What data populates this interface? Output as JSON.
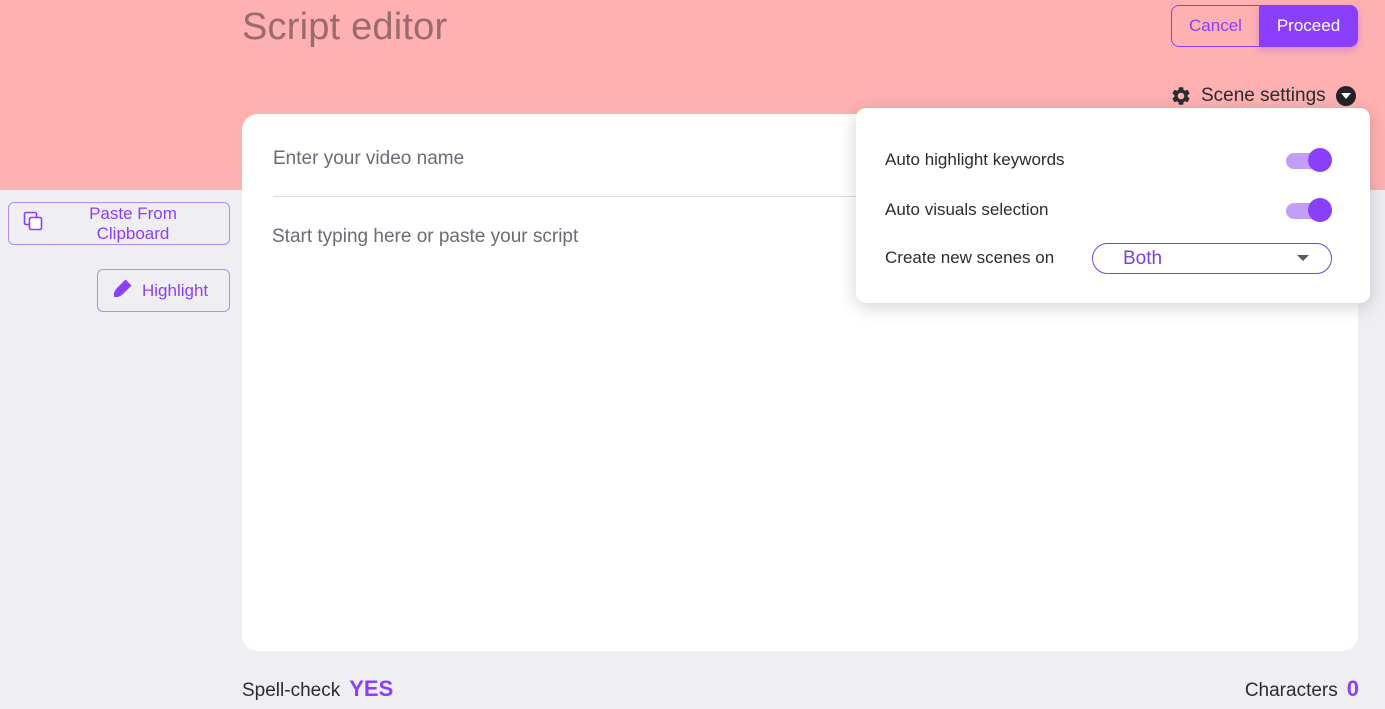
{
  "header": {
    "title": "Script editor",
    "cancel_label": "Cancel",
    "proceed_label": "Proceed",
    "scene_settings_label": "Scene settings"
  },
  "sidebar": {
    "paste_label": "Paste From Clipboard",
    "highlight_label": "Highlight"
  },
  "editor": {
    "video_name_placeholder": "Enter your video name",
    "script_placeholder": "Start typing here or paste your script"
  },
  "scene_settings_popup": {
    "rows": [
      {
        "label": "Auto highlight keywords",
        "toggle_on": true
      },
      {
        "label": "Auto visuals selection",
        "toggle_on": true
      }
    ],
    "create_scenes_label": "Create new scenes on",
    "create_scenes_value": "Both"
  },
  "footer": {
    "spellcheck_label": "Spell-check",
    "spellcheck_value": "YES",
    "characters_label": "Characters",
    "characters_value": "0"
  },
  "icons": {
    "gear": "gear-icon",
    "caret": "chevron-down-icon",
    "copy": "copy-icon",
    "marker": "marker-icon"
  },
  "colors": {
    "accent": "#8a3ffc",
    "header_band": "#ffb1b1",
    "page_bg": "#efeef3"
  }
}
